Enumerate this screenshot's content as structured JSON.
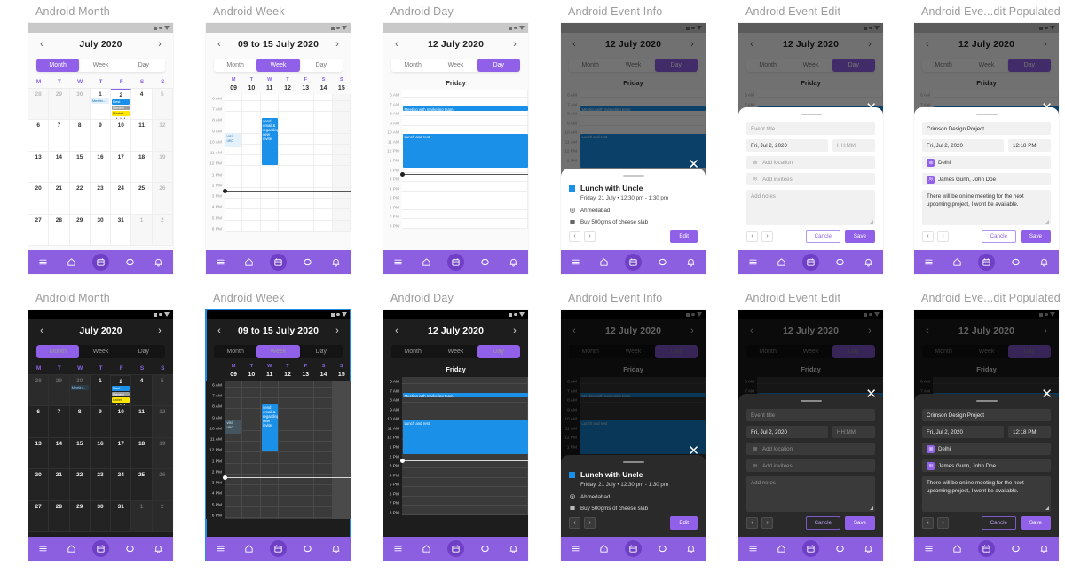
{
  "frames": [
    {
      "title": "Android Month"
    },
    {
      "title": "Android Week"
    },
    {
      "title": "Android Day"
    },
    {
      "title": "Android Event Info"
    },
    {
      "title": "Android Event Edit"
    },
    {
      "title": "Android Eve...dit Populated"
    }
  ],
  "colors": {
    "purple": "#8b5fe0",
    "purple_active": "#9061e8",
    "purple_nav_active": "#6f3fc6",
    "event_blue": "#1a90e8",
    "event_blue_soft": "#e3f1fc",
    "event_grey": "#9e9e9e",
    "event_yellow": "#ffe600",
    "selection_blue": "#1a90e8",
    "dark_bg": "#1d1d1d",
    "light_bg": "#fafafa"
  },
  "segmented": {
    "month": "Month",
    "week": "Week",
    "day": "Day"
  },
  "month_view": {
    "title": "July 2020",
    "prev": "‹",
    "next": "›",
    "dow": [
      "M",
      "T",
      "W",
      "T",
      "F",
      "S",
      "S"
    ],
    "weeks": [
      [
        {
          "num": "28",
          "out": true
        },
        {
          "num": "29",
          "out": true
        },
        {
          "num": "30",
          "out": true
        },
        {
          "num": "1",
          "out": false
        },
        {
          "num": "2",
          "out": false,
          "selected": true
        },
        {
          "num": "4",
          "out": false
        },
        {
          "num": "5",
          "out": true
        }
      ],
      [
        {
          "num": "6"
        },
        {
          "num": "7"
        },
        {
          "num": "8"
        },
        {
          "num": "9"
        },
        {
          "num": "10"
        },
        {
          "num": "11"
        },
        {
          "num": "12",
          "out": true
        }
      ],
      [
        {
          "num": "13"
        },
        {
          "num": "14"
        },
        {
          "num": "15"
        },
        {
          "num": "16"
        },
        {
          "num": "17"
        },
        {
          "num": "18"
        },
        {
          "num": "19",
          "out": true
        }
      ],
      [
        {
          "num": "20"
        },
        {
          "num": "21"
        },
        {
          "num": "22"
        },
        {
          "num": "23"
        },
        {
          "num": "24"
        },
        {
          "num": "25"
        },
        {
          "num": "26",
          "out": true
        }
      ],
      [
        {
          "num": "27"
        },
        {
          "num": "28"
        },
        {
          "num": "29"
        },
        {
          "num": "30"
        },
        {
          "num": "31"
        },
        {
          "num": "1",
          "out": true
        },
        {
          "num": "2",
          "out": true
        }
      ]
    ],
    "light_chips": {
      "col3": [
        {
          "text": "Meetin...",
          "style": "lightblue"
        }
      ],
      "col4": [
        {
          "text": "Rest",
          "style": "blue"
        },
        {
          "text": "Renew",
          "style": "grey"
        },
        {
          "text": "Market...",
          "style": "yellow"
        }
      ],
      "overflow": "• • •"
    },
    "dark_chips": {
      "col2": [
        {
          "text": "Meetin...",
          "style": "lightblue"
        }
      ],
      "col4": [
        {
          "text": "Rest",
          "style": "blue"
        },
        {
          "text": "Renew",
          "style": "grey"
        },
        {
          "text": "Label",
          "style": "yellow"
        }
      ],
      "overflow": "• • •"
    }
  },
  "week_view": {
    "title": "09 to 15 July 2020",
    "columns": [
      {
        "dow": "M",
        "num": "09"
      },
      {
        "dow": "T",
        "num": "10"
      },
      {
        "dow": "W",
        "num": "11"
      },
      {
        "dow": "T",
        "num": "12"
      },
      {
        "dow": "F",
        "num": "13"
      },
      {
        "dow": "S",
        "num": "14"
      },
      {
        "dow": "S",
        "num": "15"
      }
    ],
    "hours": [
      "6 AM",
      "7 AM",
      "8 AM",
      "9 AM",
      "10 AM",
      "11 AM",
      "12 PM",
      "1 PM",
      "2 PM",
      "3 PM",
      "4 PM",
      "5 PM",
      "6 PM"
    ],
    "events": [
      {
        "text": "visit uncl",
        "style": "soft",
        "col": 0,
        "start": 3.0,
        "end": 4.3
      },
      {
        "text": "send email & regarding new invite",
        "style": "blue",
        "col": 2,
        "start": 1.6,
        "end": 6.0
      }
    ],
    "now_position": 8.3
  },
  "day_view": {
    "title": "12 July 2020",
    "weekday": "Friday",
    "hours": [
      "6 AM",
      "7 AM",
      "8 AM",
      "9 AM",
      "10 AM",
      "11 AM",
      "12 PM",
      "1 PM",
      "2 PM",
      "3 PM",
      "4 PM",
      "5 PM",
      "6 PM",
      "7 PM",
      "8 PM"
    ],
    "events": [
      {
        "text": "Meeting with marketing team",
        "style": "blue",
        "start": 1.0,
        "end": 1.55
      },
      {
        "text": "Lunch and rest",
        "style": "blue",
        "start": 4.0,
        "end": 7.6
      }
    ],
    "now_position": 8.2
  },
  "event_info": {
    "title": "Lunch with Uncle",
    "datetime": "Friday, 21 July   •   12:30 pm - 1:30 pm",
    "location": "Ahmedabad",
    "note": "Buy 500gms of cheese slab",
    "prev": "‹",
    "next": "›",
    "edit_label": "Edit",
    "close": "✕"
  },
  "event_edit_empty": {
    "title_placeholder": "Event title",
    "date_value": "Fri, Jul 2, 2020",
    "time_placeholder": "HH:MM",
    "location_placeholder": "Add location",
    "invitees_placeholder": "Add invitees",
    "notes_placeholder": "Add notes",
    "prev": "‹",
    "next": "›",
    "cancel_label": "Cancle",
    "save_label": "Save",
    "close": "✕"
  },
  "event_edit_filled": {
    "title_value": "Crimson Design Project",
    "date_value": "Fri, Jul 2, 2020",
    "time_value": "12:18 PM",
    "location_value": "Delhi",
    "invitees_value": "James Gunn, John Doe",
    "notes_value": "There will be online meeting for the next upcoming project, I wont be available.",
    "prev": "‹",
    "next": "›",
    "cancel_label": "Cancle",
    "save_label": "Save",
    "close": "✕"
  },
  "bottom_nav": [
    {
      "icon": "menu-icon",
      "active": false
    },
    {
      "icon": "home-icon",
      "active": false
    },
    {
      "icon": "calendar-icon",
      "active": true
    },
    {
      "icon": "chat-icon",
      "active": false
    },
    {
      "icon": "bell-icon",
      "active": false
    }
  ],
  "status_bar": {
    "icons": [
      "signal-icon",
      "dot-icon",
      "wifi-icon"
    ]
  }
}
